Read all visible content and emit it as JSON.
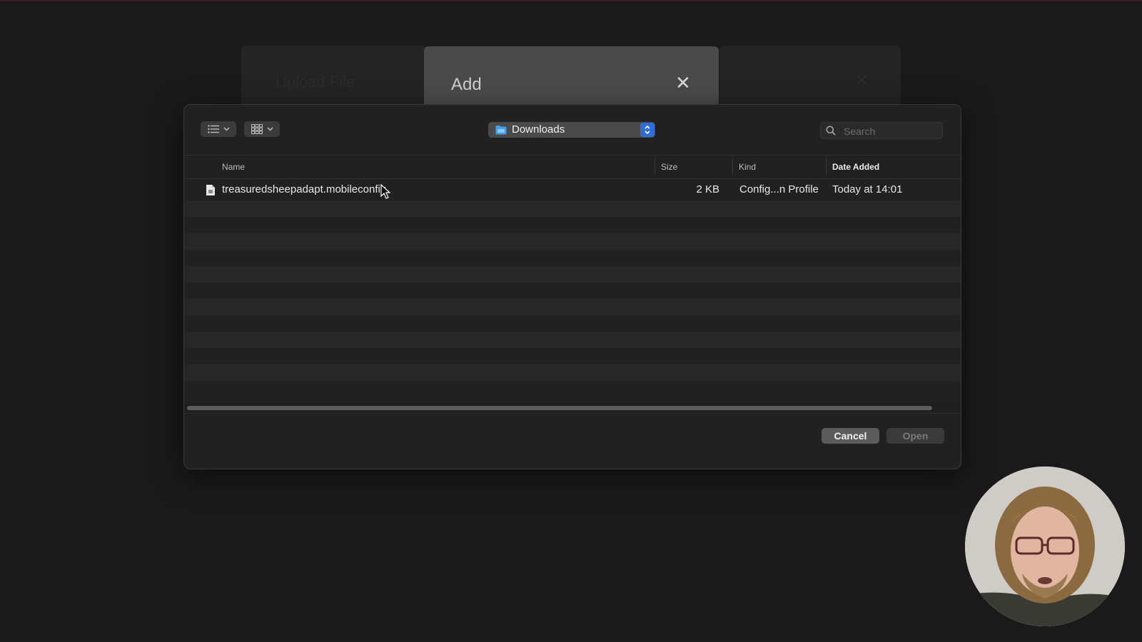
{
  "background": {
    "left_tab_title": "Upload File",
    "right_tab_close": "✕",
    "add_modal_title": "Add",
    "add_modal_close": "✕"
  },
  "dialog": {
    "toolbar": {
      "view_list_icon": "list-view-icon",
      "view_grid_icon": "grid-view-icon",
      "location": "Downloads",
      "search_placeholder": "Search"
    },
    "columns": {
      "name": "Name",
      "size": "Size",
      "kind": "Kind",
      "date_added": "Date Added"
    },
    "files": [
      {
        "name": "treasuredsheepadapt.mobileconfig",
        "size": "2 KB",
        "kind": "Config...n Profile",
        "date_added": "Today at 14:01"
      }
    ],
    "buttons": {
      "cancel": "Cancel",
      "open": "Open"
    }
  },
  "colors": {
    "accent": "#2f6ed8",
    "background": "#1a1a1a",
    "dialog": "#212121"
  }
}
